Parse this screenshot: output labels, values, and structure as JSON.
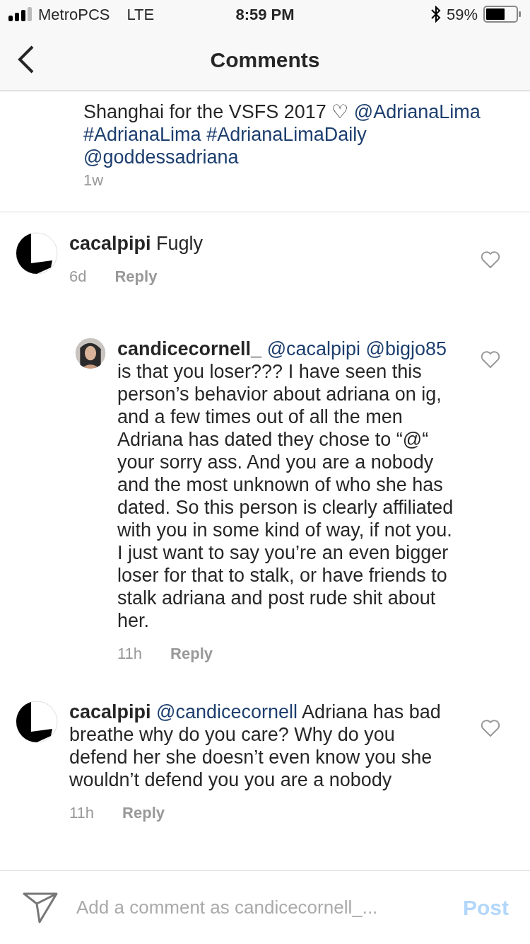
{
  "status_bar": {
    "carrier": "MetroPCS",
    "network": "LTE",
    "time": "8:59 PM",
    "battery": "59%"
  },
  "header": {
    "title": "Comments"
  },
  "caption": {
    "segments": [
      {
        "kind": "text",
        "text": "Shanghai for the VSFS 2017 ♡"
      },
      {
        "kind": "mention",
        "text": "@AdrianaLima"
      },
      {
        "kind": "mention",
        "text": "#AdrianaLima"
      },
      {
        "kind": "mention",
        "text": "#AdrianaLimaDaily"
      },
      {
        "kind": "mention",
        "text": "@goddessadriana"
      }
    ],
    "time": "1w"
  },
  "comments": [
    {
      "username": "cacalpipi",
      "segments": [
        {
          "kind": "text",
          "text": "Fugly"
        }
      ],
      "time": "6d",
      "reply_label": "Reply",
      "children": [
        {
          "username": "candicecornell_",
          "segments": [
            {
              "kind": "mention",
              "text": "@cacalpipi"
            },
            {
              "kind": "mention",
              "text": "@bigjo85"
            },
            {
              "kind": "text",
              "text": "is that you loser??? I have seen this person’s behavior about adriana on ig, and a few times out of all the men Adriana has dated they chose to “@“ your sorry ass. And you are a nobody and the most unknown of who she has dated. So this person is clearly affiliated with you in some kind of way, if not you. I just want to say you’re an even bigger loser for that to stalk, or have friends to stalk adriana and post rude shit about her."
            }
          ],
          "time": "11h",
          "reply_label": "Reply"
        }
      ]
    },
    {
      "username": "cacalpipi",
      "segments": [
        {
          "kind": "mention",
          "text": "@candicecornell"
        },
        {
          "kind": "text",
          "text": "Adriana has bad breathe why do you care? Why do you defend her she doesn’t even know you she wouldn’t defend you you are a nobody"
        }
      ],
      "time": "11h",
      "reply_label": "Reply"
    }
  ],
  "composer": {
    "placeholder": "Add a comment as candicecornell_...",
    "post_label": "Post"
  }
}
